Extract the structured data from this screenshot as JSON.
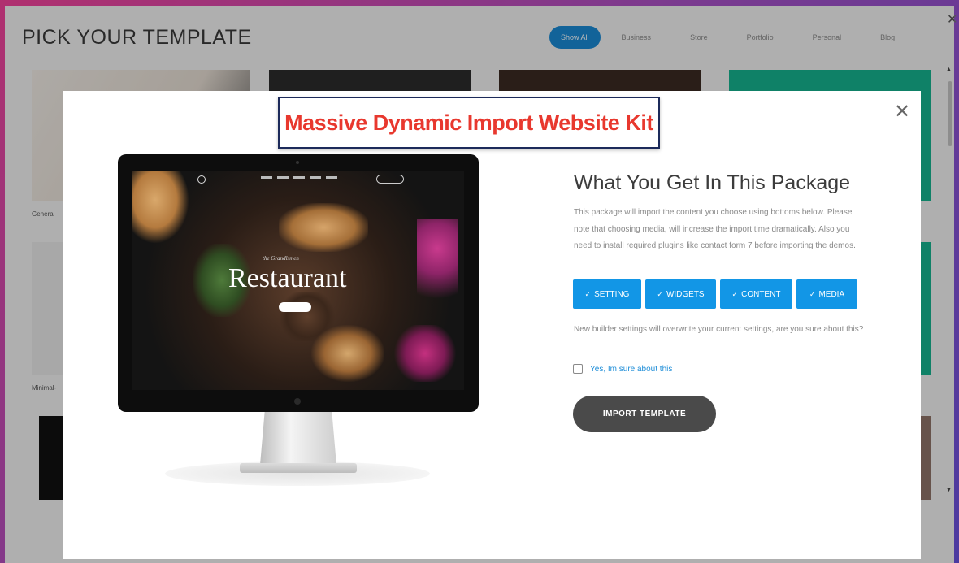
{
  "app": {
    "title": "PICK YOUR TEMPLATE",
    "filters": [
      "Show All",
      "Business",
      "Store",
      "Portfolio",
      "Personal",
      "Blog"
    ],
    "active_filter": "Show All",
    "thumb_labels": [
      "General",
      "Minimal-"
    ]
  },
  "modal": {
    "banner": "Massive Dynamic Import Website Kit",
    "preview": {
      "heading": "Restaurant",
      "subtitle": "the Grandlsmen"
    },
    "package_title": "What You Get In This Package",
    "description": "This package will import the content you choose using bottoms below. Please note that choosing media, will increase the import time dramatically. Also you need to install required plugins like contact form 7 before importing the demos.",
    "options": [
      {
        "check": "✓",
        "label": "SETTING"
      },
      {
        "check": "✓",
        "label": "WIDGETS"
      },
      {
        "check": "✓",
        "label": "CONTENT"
      },
      {
        "check": "✓",
        "label": "MEDIA"
      }
    ],
    "warning": "New builder settings will overwrite your current settings, are you sure about this?",
    "confirm_label": "Yes, Im sure about this",
    "import_button": "IMPORT TEMPLATE"
  },
  "colors": {
    "accent": "#1296e6",
    "banner_text": "#e8382e",
    "import_button": "#4a4a4a"
  }
}
